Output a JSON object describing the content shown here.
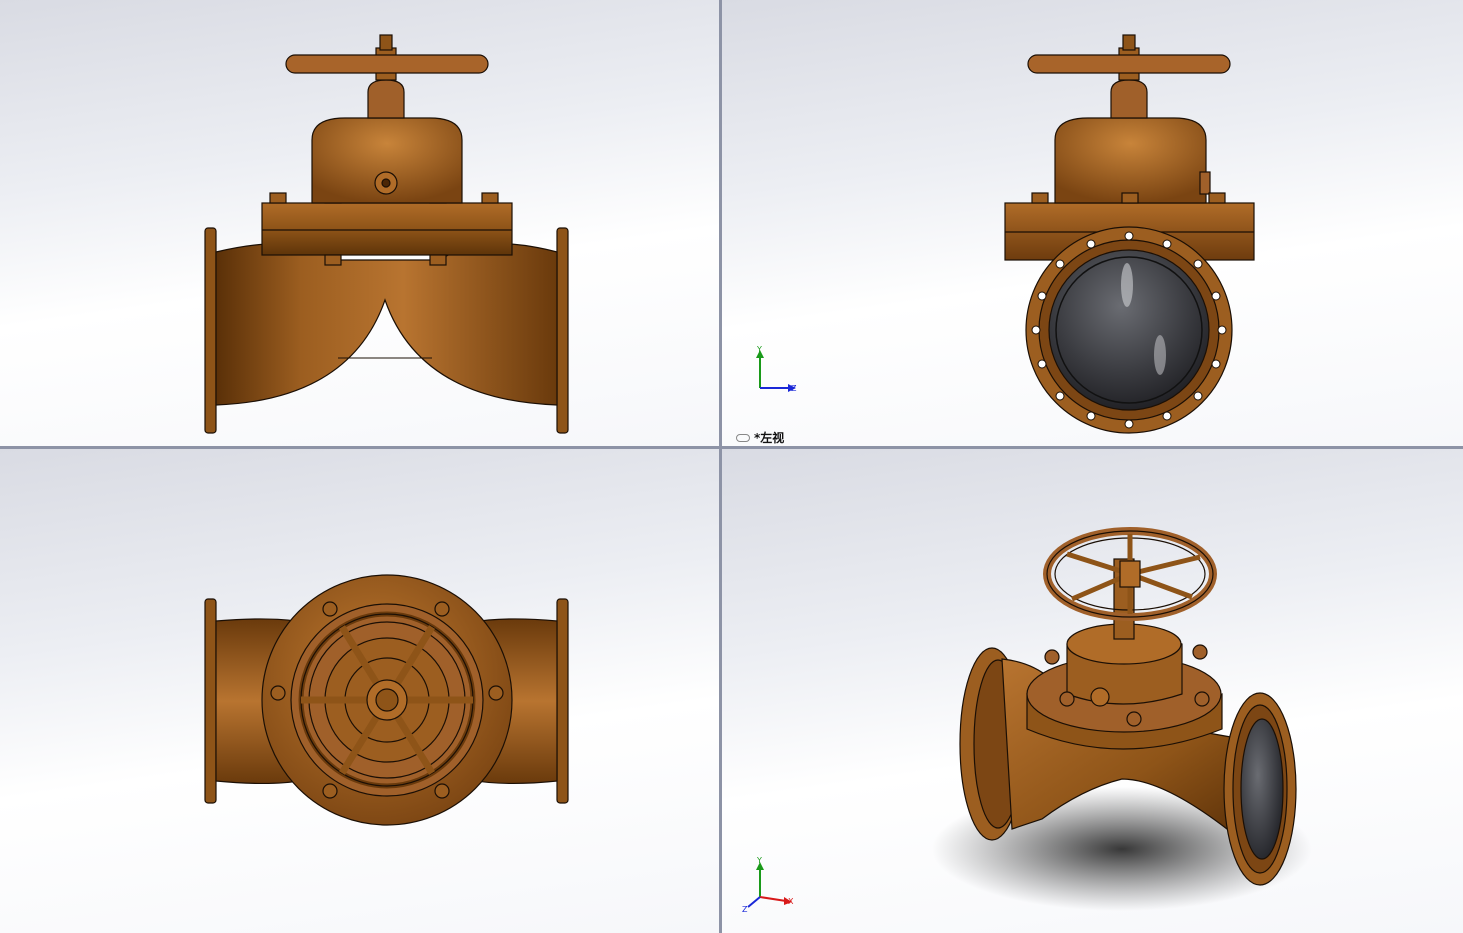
{
  "viewports": {
    "front": {
      "name": "front-view"
    },
    "left": {
      "name": "left-view",
      "label": "*左视"
    },
    "top": {
      "name": "top-view"
    },
    "iso": {
      "name": "isometric-view"
    }
  },
  "triad_left": {
    "y": "Y",
    "z": "Z"
  },
  "triad_iso": {
    "y": "Y",
    "z": "Z",
    "x": "X"
  },
  "colors": {
    "bronze": "#8e5418",
    "bronze_light": "#c07a30",
    "bronze_dark": "#5a3008",
    "outline": "#1b0f05",
    "liner": "#3b3c40",
    "axis_y": "#1a9a1a",
    "axis_z": "#1a28d8",
    "axis_x": "#d81a1a"
  }
}
